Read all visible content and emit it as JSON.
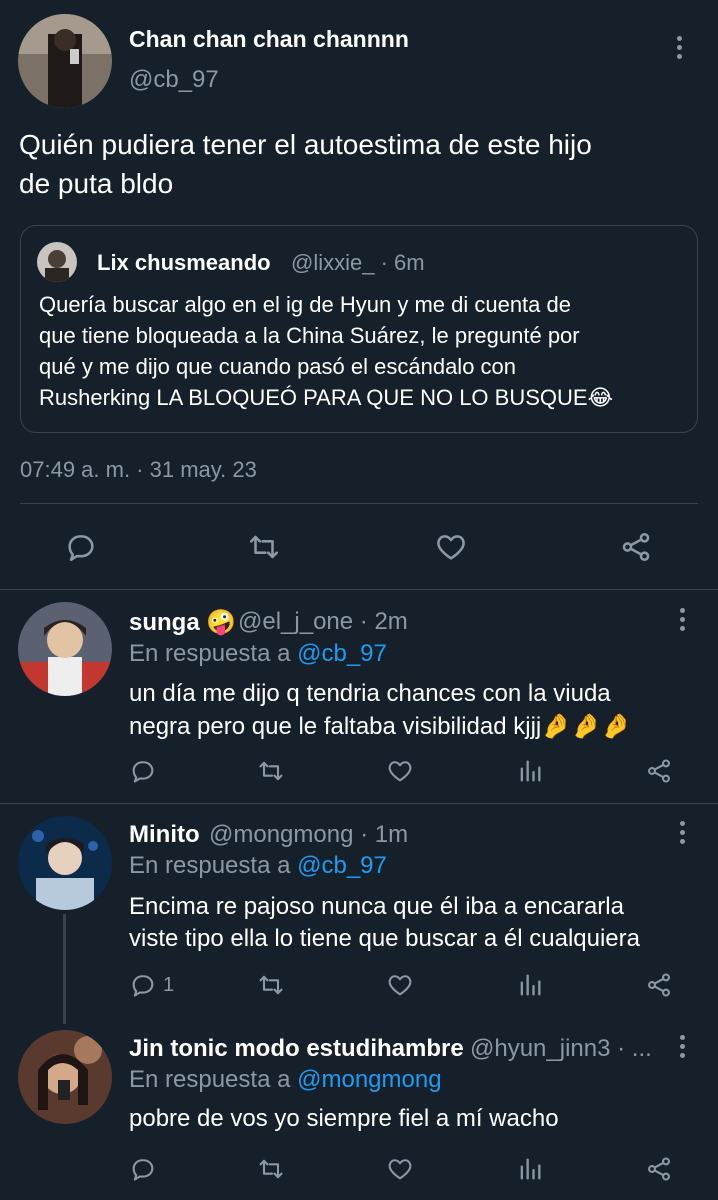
{
  "main_tweet": {
    "author_name": "Chan chan chan channnn",
    "author_handle": "@cb_97",
    "text_line1": "Quién pudiera tener el autoestima de este hijo",
    "text_line2": "de puta bldo",
    "timestamp": "07:49 a. m. · 31 may. 23",
    "quoted": {
      "author_name": "Lix chusmeando",
      "author_handle": "@lixxie_ · 6m",
      "line1": "Quería buscar algo en el ig de Hyun y me di cuenta de",
      "line2": "que tiene bloqueada a la China Suárez, le pregunté por",
      "line3": "qué y me dijo que cuando pasó el escándalo con",
      "line4": "Rusherking LA BLOQUEÓ PARA QUE NO LO BUSQUE😂"
    }
  },
  "replies": [
    {
      "author_name": "sunga 🤪",
      "author_handle": "@el_j_one · 2m",
      "reply_prefix": "En respuesta a",
      "reply_to": "@cb_97",
      "line1": "un día me dijo q tendria chances con la viuda",
      "line2": "negra pero que le faltaba visibilidad kjjj🤌🤌🤌",
      "reply_count": ""
    },
    {
      "author_name": "Minito",
      "author_handle": "@mongmong · 1m",
      "reply_prefix": "En respuesta a",
      "reply_to": "@cb_97",
      "line1": "Encima re pajoso nunca que él iba a encararla",
      "line2": "viste tipo ella lo tiene que buscar a él cualquiera",
      "reply_count": "1"
    },
    {
      "author_name": "Jin tonic modo estudihambre",
      "author_handle": "@hyun_jinn3 · ...",
      "reply_prefix": "En respuesta a",
      "reply_to": "@mongmong",
      "line1": "pobre de vos yo siempre fiel a mí wacho",
      "line2": "",
      "reply_count": ""
    }
  ],
  "colors": {
    "background": "#15202b",
    "text": "#ffffff",
    "muted": "#8b98a5",
    "link": "#1d9bf0",
    "border": "#38444d"
  },
  "icons": [
    "reply-icon",
    "retweet-icon",
    "like-icon",
    "views-icon",
    "share-icon",
    "more-icon"
  ]
}
